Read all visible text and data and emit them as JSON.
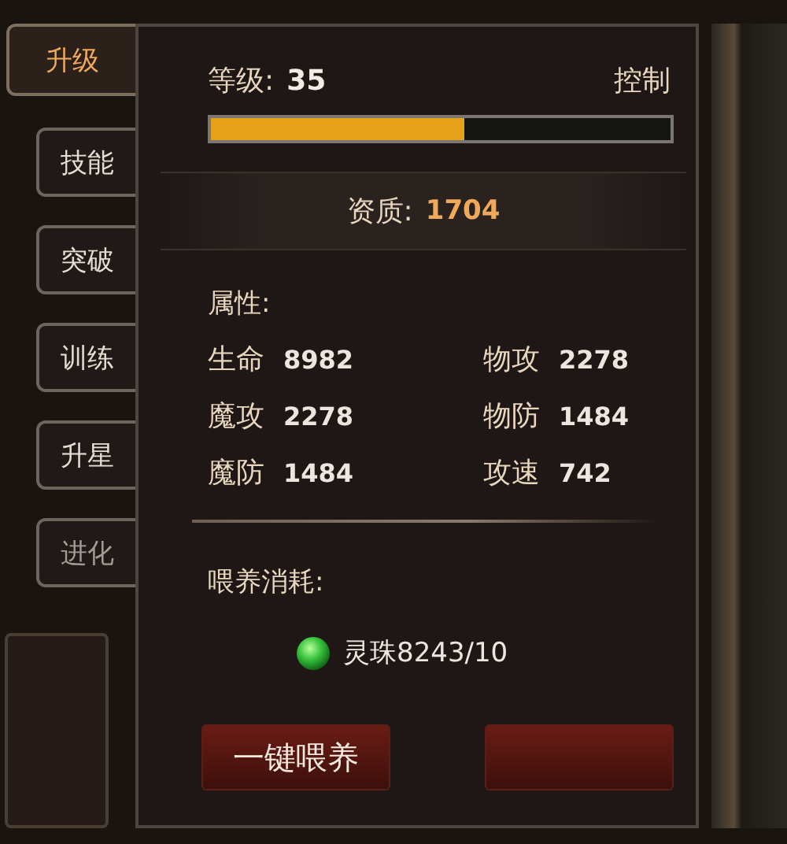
{
  "tabs": [
    {
      "label": "升级",
      "selected": true,
      "disabled": false
    },
    {
      "label": "技能",
      "selected": false,
      "disabled": false
    },
    {
      "label": "突破",
      "selected": false,
      "disabled": false
    },
    {
      "label": "训练",
      "selected": false,
      "disabled": false
    },
    {
      "label": "升星",
      "selected": false,
      "disabled": false
    },
    {
      "label": "进化",
      "selected": false,
      "disabled": true
    }
  ],
  "level": {
    "label": "等级:",
    "value": "35",
    "type": "控制",
    "level": 0.55
  },
  "aptitude": {
    "label": "资质:",
    "value": "1704"
  },
  "attributes": {
    "title": "属性:",
    "items": [
      {
        "name": "生命",
        "value": "8982"
      },
      {
        "name": "物攻",
        "value": "2278"
      },
      {
        "name": "魔攻",
        "value": "2278"
      },
      {
        "name": "物防",
        "value": "1484"
      },
      {
        "name": "魔防",
        "value": "1484"
      },
      {
        "name": "攻速",
        "value": "742"
      }
    ]
  },
  "feed": {
    "title": "喂养消耗:",
    "cost": "灵珠8243/10"
  },
  "buttons": [
    {
      "kind": "text",
      "label": "一键喂养"
    },
    {
      "kind": "blank"
    }
  ]
}
